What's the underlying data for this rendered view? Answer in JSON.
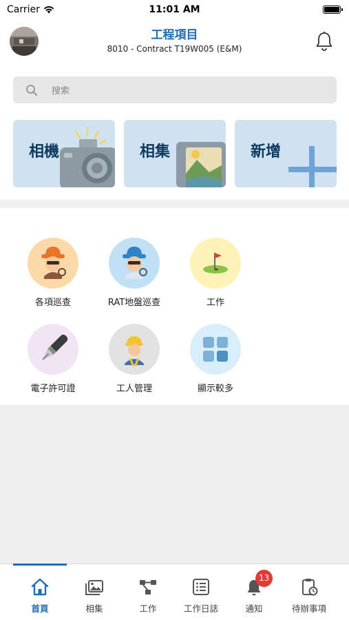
{
  "status_bar": {
    "carrier": "Carrier",
    "time": "11:01 AM"
  },
  "header": {
    "title": "工程項目",
    "subtitle": "8010 - Contract T19W005 (E&M)"
  },
  "search": {
    "placeholder": "搜索"
  },
  "cards": [
    {
      "label": "相機",
      "icon": "camera-icon"
    },
    {
      "label": "相集",
      "icon": "photo-album-icon"
    },
    {
      "label": "新增",
      "icon": "plus-icon"
    }
  ],
  "functions": [
    {
      "label": "各項巡查",
      "icon": "detective-icon",
      "color": "#fcd9a8"
    },
    {
      "label": "RAT地盤巡查",
      "icon": "detective-blue-icon",
      "color": "#bfe0f5"
    },
    {
      "label": "工作",
      "icon": "golf-flag-icon",
      "color": "#fdf3b6"
    },
    {
      "label": "電子許可證",
      "icon": "fountain-pen-icon",
      "color": "#f1e4f4"
    },
    {
      "label": "工人管理",
      "icon": "construction-worker-icon",
      "color": "#e2e2e2"
    },
    {
      "label": "顯示較多",
      "icon": "grid-icon",
      "color": "#d9eefb"
    }
  ],
  "tabs": [
    {
      "label": "首頁",
      "icon": "home-icon",
      "active": true
    },
    {
      "label": "相集",
      "icon": "gallery-icon",
      "active": false
    },
    {
      "label": "工作",
      "icon": "workflow-icon",
      "active": false
    },
    {
      "label": "工作日誌",
      "icon": "log-list-icon",
      "active": false
    },
    {
      "label": "通知",
      "icon": "notification-bell-icon",
      "active": false,
      "badge": "13"
    },
    {
      "label": "待辦事項",
      "icon": "todo-clipboard-icon",
      "active": false
    }
  ],
  "colors": {
    "accent": "#1f6db5",
    "badge": "#e53935",
    "card_bg": "#cfe2f0"
  }
}
